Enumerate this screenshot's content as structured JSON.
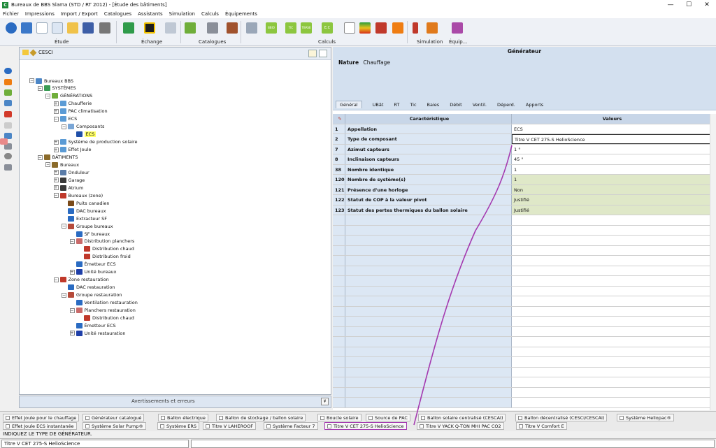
{
  "window": {
    "title": "Bureaux de BBS Slama (STD / RT 2012) - [Étude des bâtiments]",
    "app_icon": "C",
    "controls": [
      "—",
      "☐",
      "✕"
    ]
  },
  "menu": [
    "Fichier",
    "Impressions",
    "Import / Export",
    "Catalogues",
    "Assistants",
    "Simulation",
    "Calculs",
    "Équipements"
  ],
  "ribbon": {
    "groups": [
      "Étude",
      "Échange",
      "Catalogues",
      "Calculs",
      "Simulation",
      "Équip..."
    ],
    "buttons": [
      "help-icon",
      "book-icon",
      "new-doc-icon",
      "copy-icon",
      "open-folder-icon",
      "save-icon",
      "print-icon",
      "import-icon",
      "export-icon",
      "network-icon",
      "catalogue-icon",
      "tools-icon",
      "library-icon",
      "calculator-icon",
      "bbio-icon",
      "tic-icon",
      "tbase-icon",
      "ec-icon",
      "table-icon",
      "energy-label-icon",
      "summer-icon",
      "warning-icon",
      "thermometer-icon",
      "simulation-icon",
      "equipment-icon"
    ],
    "bbio": "BBIO",
    "tic": "TIC",
    "tbase": "TBASE",
    "ec": "E.C"
  },
  "tree": {
    "tab": "CESCI",
    "nodes": [
      {
        "label": "Bureaux BBS",
        "level": 0,
        "exp": "−",
        "icon": "house"
      },
      {
        "label": "SYSTÈMES",
        "level": 1,
        "exp": "−",
        "icon": "system"
      },
      {
        "label": "GÉNÉRATIONS",
        "level": 2,
        "exp": "−",
        "icon": "gen"
      },
      {
        "label": "Chaufferie",
        "level": 3,
        "exp": "+",
        "icon": "gear"
      },
      {
        "label": "PAC climatisation",
        "level": 3,
        "exp": "+",
        "icon": "gear"
      },
      {
        "label": "ECS",
        "level": 3,
        "exp": "−",
        "icon": "gear"
      },
      {
        "label": "Composants",
        "level": 4,
        "exp": "−",
        "icon": "comp"
      },
      {
        "label": "ECS",
        "level": 5,
        "exp": "",
        "icon": "t",
        "selected": true
      },
      {
        "label": "Système de production solaire",
        "level": 3,
        "exp": "+",
        "icon": "gear"
      },
      {
        "label": "Effet Joule",
        "level": 3,
        "exp": "+",
        "icon": "gear"
      },
      {
        "label": "BÂTIMENTS",
        "level": 1,
        "exp": "−",
        "icon": "bat"
      },
      {
        "label": "Bureaux",
        "level": 2,
        "exp": "−",
        "icon": "bat"
      },
      {
        "label": "Onduleur",
        "level": 3,
        "exp": "+",
        "icon": "ond"
      },
      {
        "label": "Garage",
        "level": 3,
        "exp": "+",
        "icon": "garage"
      },
      {
        "label": "Atrium",
        "level": 3,
        "exp": "+",
        "icon": "garage"
      },
      {
        "label": "Bureaux (zone)",
        "level": 3,
        "exp": "−",
        "icon": "zone"
      },
      {
        "label": "Puits canadien",
        "level": 4,
        "exp": "",
        "icon": "puits"
      },
      {
        "label": "DAC bureaux",
        "level": 4,
        "exp": "",
        "icon": "dac"
      },
      {
        "label": "Extracteur SF",
        "level": 4,
        "exp": "",
        "icon": "dac"
      },
      {
        "label": "Groupe bureaux",
        "level": 4,
        "exp": "−",
        "icon": "grp"
      },
      {
        "label": "SF bureaux",
        "level": 5,
        "exp": "",
        "icon": "sf"
      },
      {
        "label": "Distribution planchers",
        "level": 5,
        "exp": "−",
        "icon": "dist"
      },
      {
        "label": "Distribution chaud",
        "level": 6,
        "exp": "",
        "icon": "red"
      },
      {
        "label": "Distribution froid",
        "level": 6,
        "exp": "",
        "icon": "red"
      },
      {
        "label": "Émetteur ECS",
        "level": 5,
        "exp": "",
        "icon": "em"
      },
      {
        "label": "Unité bureaux",
        "level": 5,
        "exp": "+",
        "icon": "unit"
      },
      {
        "label": "Zone restauration",
        "level": 3,
        "exp": "−",
        "icon": "zone"
      },
      {
        "label": "DAC restauration",
        "level": 4,
        "exp": "",
        "icon": "dac"
      },
      {
        "label": "Groupe restauration",
        "level": 4,
        "exp": "−",
        "icon": "grp"
      },
      {
        "label": "Ventilation restauration",
        "level": 5,
        "exp": "",
        "icon": "sf"
      },
      {
        "label": "Planchers restauration",
        "level": 5,
        "exp": "−",
        "icon": "dist"
      },
      {
        "label": "Distribution chaud",
        "level": 6,
        "exp": "",
        "icon": "red"
      },
      {
        "label": "Émetteur ECS",
        "level": 5,
        "exp": "",
        "icon": "em"
      },
      {
        "label": "Unité restauration",
        "level": 5,
        "exp": "+",
        "icon": "unit"
      }
    ]
  },
  "warnings": {
    "label": "Avertissements et erreurs",
    "btn": "¥"
  },
  "generator": {
    "title": "Générateur",
    "nature_label": "Nature",
    "nature_value": "Chauffage",
    "tabs": [
      "Général",
      "UBât",
      "RT",
      "Tic",
      "Baies",
      "Débit",
      "Ventil.",
      "Déperd.",
      "Apports"
    ],
    "grid_header": {
      "num": "",
      "char": "Caractéristique",
      "val": "Valeurs"
    },
    "rows": [
      {
        "n": "1",
        "c": "Appellation",
        "v": "ECS",
        "style": ""
      },
      {
        "n": "2",
        "c": "Type de composant",
        "v": "Titre V CET 275-S HelioScience",
        "style": "active"
      },
      {
        "n": "7",
        "c": "Azimut capteurs",
        "v": "1 °",
        "style": ""
      },
      {
        "n": "8",
        "c": "Inclinaison capteurs",
        "v": "45 °",
        "style": ""
      },
      {
        "n": "38",
        "c": "Nombre identique",
        "v": "1",
        "style": ""
      },
      {
        "n": "120",
        "c": "Nombre de système(s)",
        "v": "1",
        "style": "green"
      },
      {
        "n": "121",
        "c": "Présence d'une horloge",
        "v": "Non",
        "style": "green"
      },
      {
        "n": "122",
        "c": "Statut de COP à la valeur pivot",
        "v": "Justifié",
        "style": "green"
      },
      {
        "n": "123",
        "c": "Statut des pertes thermiques du ballon solaire",
        "v": "Justifié",
        "style": "green"
      }
    ]
  },
  "palette": {
    "row1": [
      "Effet Joule pour le chauffage",
      "Générateur catalogué",
      "Ballon électrique",
      "Ballon de stockage / ballon solaire",
      "Boucle solaire",
      "Source de PAC",
      "Ballon solaire centralisé (CESCAI)",
      "Ballon décentralisé (CESCI/CESCAI)",
      "Système Heliopac®"
    ],
    "row2": [
      "Effet Joule ECS instantanée",
      "Système Solar Pump®",
      "Système ERS",
      "Titre V LAHEROOF",
      "Système Facteur 7",
      "Titre V CET 275-S HelioScience",
      "Titre V YACK Q-TON MHI PAC CO2",
      "Titre V Comfort E"
    ],
    "highlighted": "Titre V CET 275-S HelioScience"
  },
  "hint": "INDIQUEZ LE TYPE DE GÉNÉRATEUR.",
  "status": {
    "field": "Titre V CET 275-S HelioScience"
  }
}
